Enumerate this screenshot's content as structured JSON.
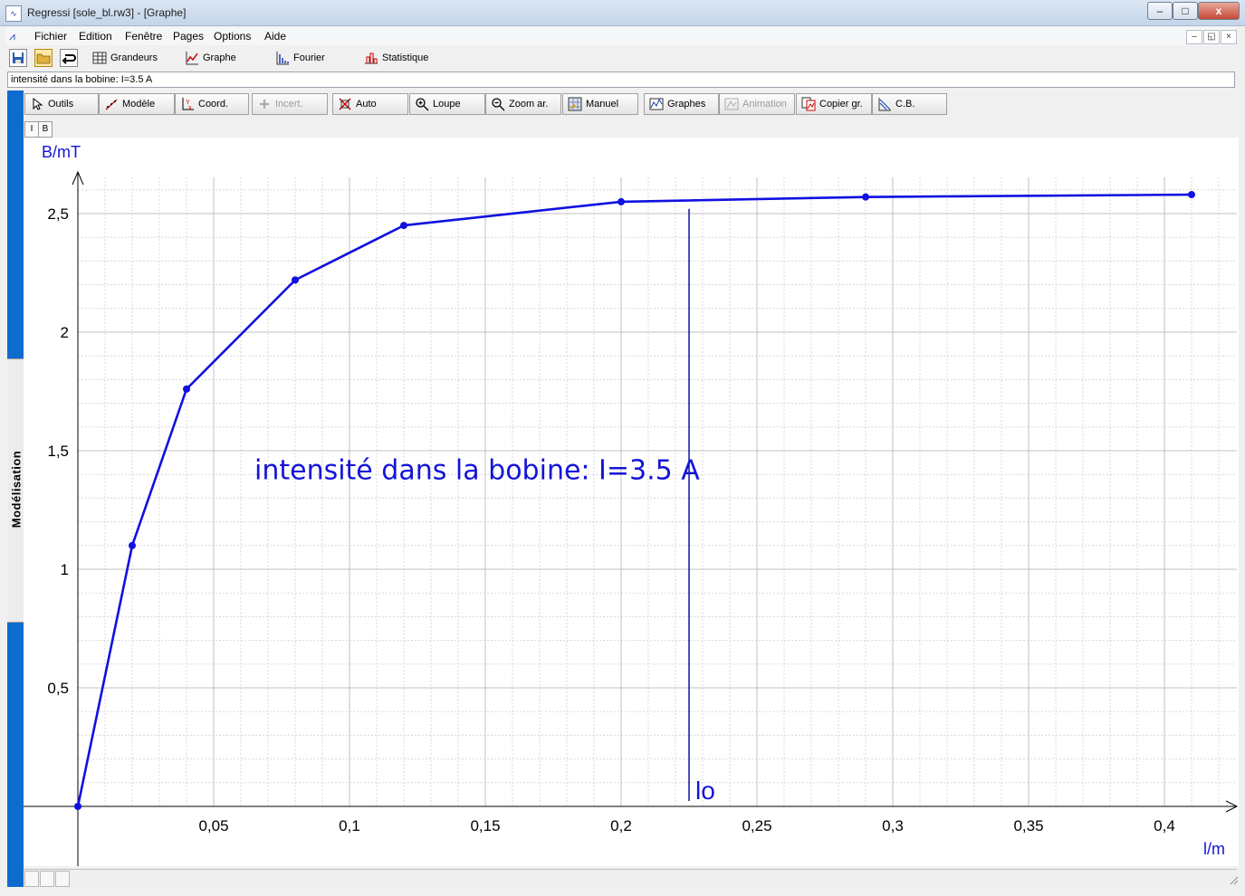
{
  "window": {
    "title": "Regressi [sole_bl.rw3] - [Graphe]",
    "app_icon": "regressi-app-icon",
    "controls": {
      "minimize": "–",
      "maximize": "□",
      "close": "x"
    }
  },
  "menu": {
    "items": [
      "Fichier",
      "Edition",
      "Fenêtre",
      "Pages",
      "Options",
      "Aide"
    ],
    "mdi_controls": {
      "minimize": "–",
      "restore": "◱",
      "close": "×"
    }
  },
  "toolbar_main": {
    "save_icon": "save-icon",
    "open_icon": "open-folder-icon",
    "back_icon": "return-arrow-icon",
    "grandeurs": "Grandeurs",
    "graphe": "Graphe",
    "fourier": "Fourier",
    "statistique": "Statistique"
  },
  "info_text": "intensité dans la bobine: I=3.5 A",
  "toolbar_graph": {
    "outils": "Outils",
    "modele": "Modèle",
    "coord": "Coord.",
    "incert": "Incert.",
    "auto": "Auto",
    "loupe": "Loupe",
    "zoom_ar": "Zoom ar.",
    "manuel": "Manuel",
    "graphes": "Graphes",
    "animation": "Animation",
    "copier": "Copier gr.",
    "cb": "C.B."
  },
  "page_buttons": [
    "I",
    "B"
  ],
  "side_tab": "Modélisation",
  "chart_data": {
    "type": "line",
    "x": [
      0,
      0.02,
      0.04,
      0.08,
      0.12,
      0.2,
      0.29,
      0.41
    ],
    "series": [
      {
        "values": [
          0,
          1.1,
          1.76,
          2.22,
          2.45,
          2.55,
          2.57,
          2.58
        ],
        "color": "#1010e0",
        "markers": true
      }
    ],
    "xlabel": "l/m",
    "ylabel": "B/mT",
    "xlim": [
      0,
      0.425
    ],
    "ylim": [
      0,
      2.65
    ],
    "xticks": [
      0.05,
      0.1,
      0.15,
      0.2,
      0.25,
      0.3,
      0.35,
      0.4
    ],
    "xtick_labels": [
      "0,05",
      "0,1",
      "0,15",
      "0,2",
      "0,25",
      "0,3",
      "0,35",
      "0,4"
    ],
    "yticks": [
      0.5,
      1,
      1.5,
      2,
      2.5
    ],
    "ytick_labels": [
      "0,5",
      "1",
      "1,5",
      "2",
      "2,5"
    ],
    "grid": true,
    "annotation": "intensité dans la bobine: I=3.5 A",
    "marker_line": {
      "x": 0.225,
      "y_top": 2.52,
      "label": "lo"
    },
    "text_color": "#1414d8"
  }
}
